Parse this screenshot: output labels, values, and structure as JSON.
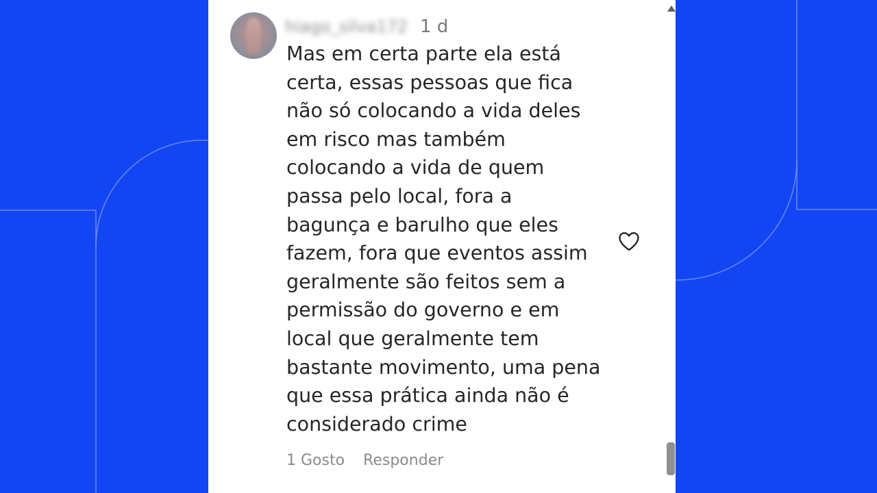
{
  "colors": {
    "background": "#1346f2",
    "card": "#ffffff",
    "text": "#262626",
    "muted": "#8a8a8a"
  },
  "comment": {
    "username": "hiago_silva172",
    "time": "1 d",
    "lines": [
      "Mas em certa parte ela está",
      "certa, essas pessoas que fica",
      "não só colocando a vida deles",
      "em risco mas também",
      "colocando a vida de quem",
      "passa pelo local, fora a",
      "bagunça e barulho que eles",
      "fazem, fora que eventos assim",
      "geralmente são feitos sem a",
      "permissão do governo e em",
      "local que geralmente tem",
      "bastante movimento, uma pena",
      "que essa prática ainda não é",
      "considerado crime"
    ],
    "likes_label": "1 Gosto",
    "reply_label": "Responder"
  },
  "icons": {
    "like": "heart-outline-icon",
    "scroll_up": "caret-up-icon"
  }
}
